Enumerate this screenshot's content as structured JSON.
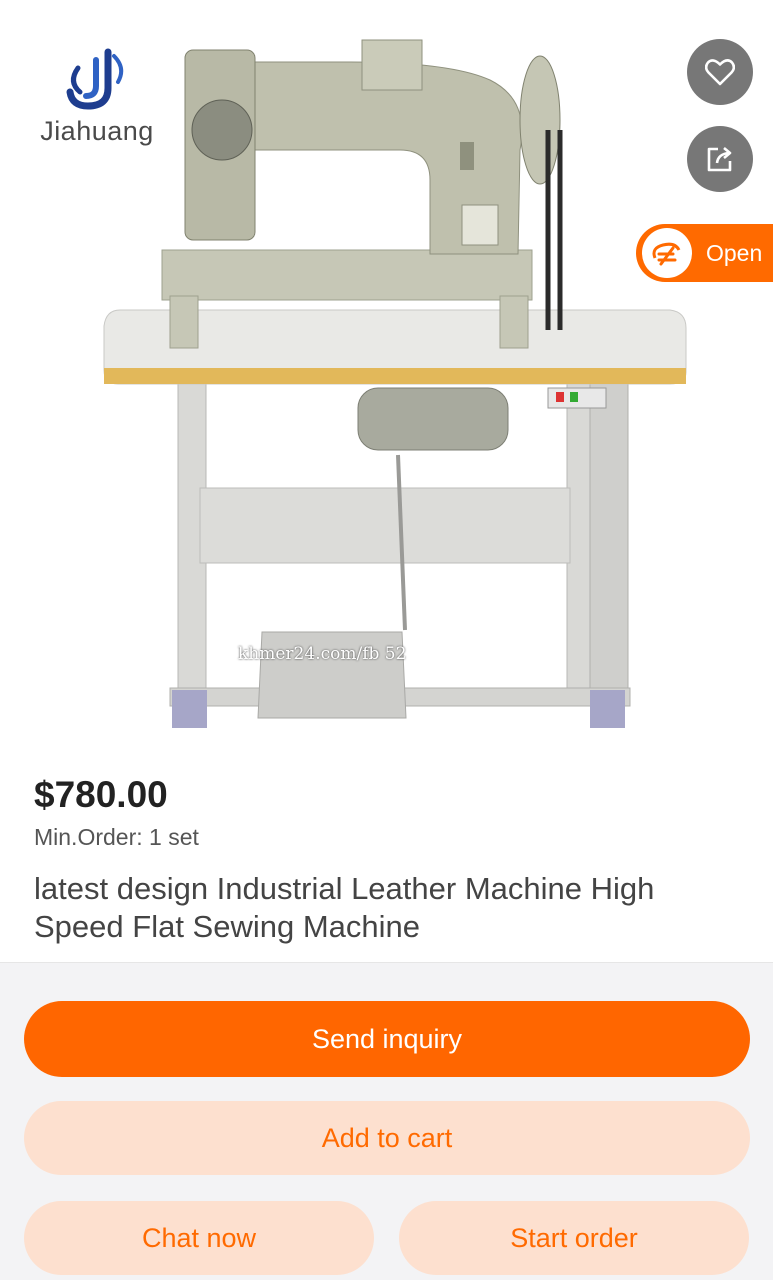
{
  "brand": {
    "name": "Jiahuang",
    "logo_icon": "jiahuang-logo-icon"
  },
  "overlay": {
    "favorite_icon": "heart-icon",
    "share_icon": "share-icon",
    "open_label": "Open",
    "open_icon": "alibaba-logo-icon"
  },
  "product": {
    "image": "industrial-sewing-machine-on-table",
    "watermark": "khmer24.com/fb                    52",
    "price": "$780.00",
    "min_order": "Min.Order: 1 set",
    "title": "latest design Industrial Leather Machine High Speed Flat Sewing Machine"
  },
  "actions": {
    "send_inquiry": "Send inquiry",
    "add_to_cart": "Add to cart",
    "chat_now": "Chat now",
    "start_order": "Start order"
  },
  "colors": {
    "accent": "#ff6600",
    "accent_soft": "#fde0cf",
    "overlay_button": "#777777"
  }
}
